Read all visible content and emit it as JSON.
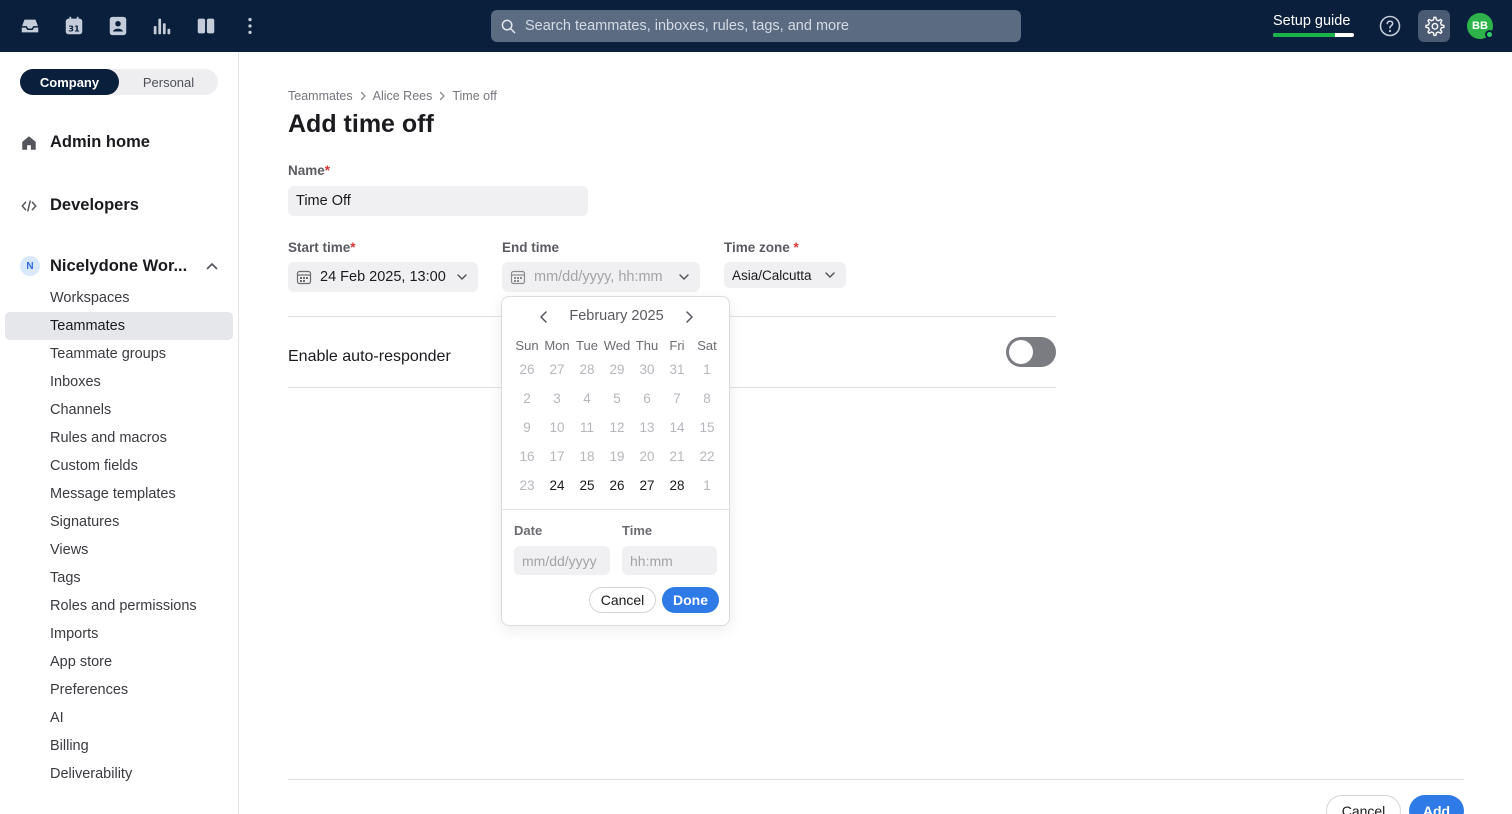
{
  "topbar": {
    "icons": [
      "inbox-icon",
      "calendar-icon",
      "contacts-icon",
      "analytics-icon",
      "layout-icon",
      "more-icon"
    ],
    "calendar_day": "31",
    "search_placeholder": "Search teammates, inboxes, rules, tags, and more",
    "setup_guide_label": "Setup guide",
    "setup_progress_percent": 77,
    "avatar_initials": "BB",
    "colors": {
      "bar": "#0a1f3c",
      "accent": "#2e7be8",
      "progress": "#19b24b"
    }
  },
  "sidebar": {
    "scope_tabs": [
      "Company",
      "Personal"
    ],
    "active_scope": "Company",
    "admin_home": "Admin home",
    "developers": "Developers",
    "workspace_badge": "N",
    "workspace_title": "Nicelydone Wor...",
    "items": [
      "Workspaces",
      "Teammates",
      "Teammate groups",
      "Inboxes",
      "Channels",
      "Rules and macros",
      "Custom fields",
      "Message templates",
      "Signatures",
      "Views",
      "Tags",
      "Roles and permissions",
      "Imports",
      "App store",
      "Preferences",
      "AI",
      "Billing",
      "Deliverability"
    ],
    "active_item": "Teammates"
  },
  "main": {
    "breadcrumb": [
      "Teammates",
      "Alice Rees",
      "Time off"
    ],
    "title": "Add time off",
    "name_label": "Name",
    "name_value": "Time Off",
    "start_label": "Start time",
    "start_value": "24 Feb 2025, 13:00",
    "end_label": "End time",
    "end_placeholder": "mm/dd/yyyy, hh:mm",
    "tz_label": "Time zone",
    "tz_value": "Asia/Calcutta",
    "auto_responder_label": "Enable auto-responder",
    "auto_responder_on": false,
    "required_mark": "*"
  },
  "picker": {
    "month_label": "February 2025",
    "weekdays": [
      "Sun",
      "Mon",
      "Tue",
      "Wed",
      "Thu",
      "Fri",
      "Sat"
    ],
    "weeks": [
      [
        "26",
        "27",
        "28",
        "29",
        "30",
        "31",
        "1"
      ],
      [
        "2",
        "3",
        "4",
        "5",
        "6",
        "7",
        "8"
      ],
      [
        "9",
        "10",
        "11",
        "12",
        "13",
        "14",
        "15"
      ],
      [
        "16",
        "17",
        "18",
        "19",
        "20",
        "21",
        "22"
      ],
      [
        "23",
        "24",
        "25",
        "26",
        "27",
        "28",
        "1"
      ]
    ],
    "enabled_days_last_week": [
      "24",
      "25",
      "26",
      "27",
      "28"
    ],
    "date_label": "Date",
    "time_label": "Time",
    "date_placeholder": "mm/dd/yyyy",
    "time_placeholder": "hh:mm",
    "cancel_label": "Cancel",
    "done_label": "Done"
  },
  "footer": {
    "cancel_label": "Cancel",
    "add_label": "Add"
  }
}
